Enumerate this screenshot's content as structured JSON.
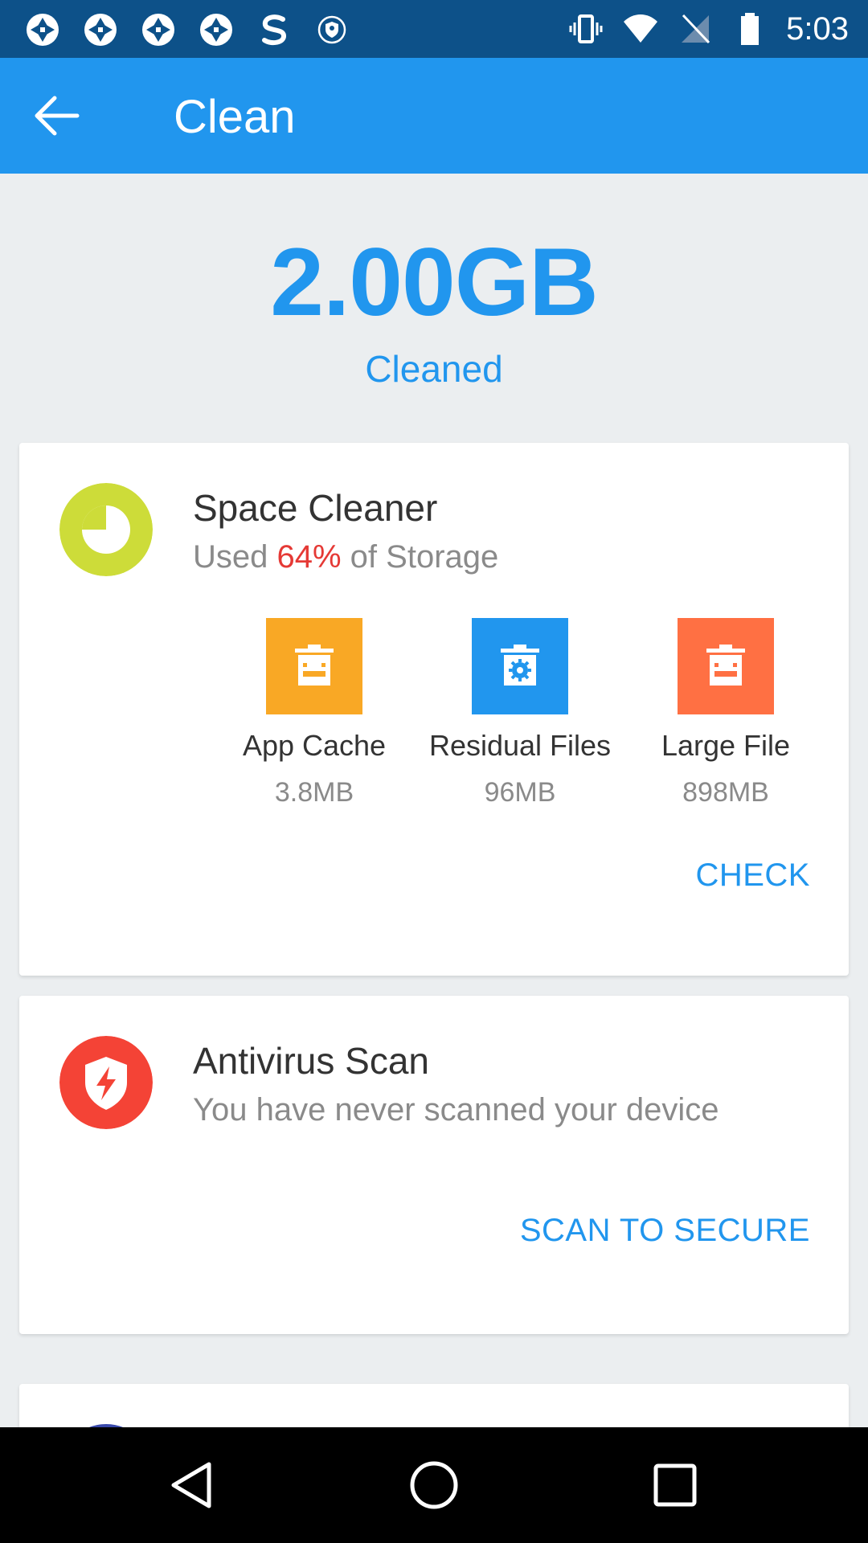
{
  "status_bar": {
    "time": "5:03",
    "left_icons": [
      "shutter-icon",
      "shutter-icon",
      "shutter-icon",
      "shutter-icon",
      "s-logo-icon",
      "shield-icon"
    ],
    "right_icons": [
      "vibrate-icon",
      "wifi-icon",
      "no-signal-icon",
      "battery-icon"
    ]
  },
  "app_bar": {
    "title": "Clean",
    "back_icon": "arrow-left-icon"
  },
  "hero": {
    "amount": "2.00GB",
    "label": "Cleaned"
  },
  "space_cleaner": {
    "title": "Space Cleaner",
    "subtitle_prefix": "Used ",
    "percent": "64%",
    "subtitle_suffix": " of Storage",
    "icon": "pie-chart-icon",
    "icon_color": "#cddc39",
    "tiles": [
      {
        "label": "App Cache",
        "size": "3.8MB",
        "color": "#f9a825",
        "icon": "android-bin-icon"
      },
      {
        "label": "Residual Files",
        "size": "96MB",
        "color": "#2196ee",
        "icon": "gear-bin-icon"
      },
      {
        "label": "Large File",
        "size": "898MB",
        "color": "#ff7043",
        "icon": "android-bin-icon"
      }
    ],
    "action": "CHECK"
  },
  "antivirus": {
    "title": "Antivirus Scan",
    "subtitle": "You have never scanned your device",
    "icon": "shield-bolt-icon",
    "icon_color": "#f44336",
    "action": "SCAN TO SECURE"
  },
  "nav_bar": {
    "icons": [
      "back-triangle-icon",
      "home-circle-icon",
      "recents-square-icon"
    ]
  },
  "colors": {
    "accent": "#2196ee",
    "status_bar": "#0d5189",
    "highlight": "#e53935"
  }
}
